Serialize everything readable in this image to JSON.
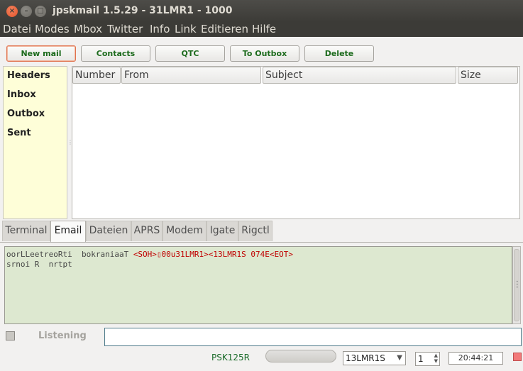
{
  "window": {
    "title": "jpskmail 1.5.29 - 31LMR1 - 1000",
    "controls": {
      "close": "×",
      "minimize": "–",
      "maximize": "□"
    }
  },
  "menu": [
    "Datei",
    "Modes",
    "Mbox",
    "Twitter",
    "Info",
    "Link",
    "Editieren",
    "Hilfe"
  ],
  "toolbar": [
    "New mail",
    "Contacts",
    "QTC",
    "To Outbox",
    "Delete"
  ],
  "sidebar": [
    "Headers",
    "Inbox",
    "Outbox",
    "Sent"
  ],
  "table": {
    "columns": [
      "Number",
      "From",
      "Subject",
      "Size"
    ],
    "rows": []
  },
  "tabs": [
    "Terminal",
    "Email",
    "Dateien",
    "APRS",
    "Modem",
    "Igate",
    "Rigctl"
  ],
  "active_tab": "Email",
  "terminal": {
    "line1_plain": "oorLLeetreoRti  bokraniaaT ",
    "line1_red": "<SOH>▯00u31LMR1><13LMR1S 074E<EOT>",
    "line2": "srnoi R  nrtpt"
  },
  "status": {
    "listening": "Listening",
    "mode": "PSK125R",
    "callsign": "13LMR1S",
    "spin_value": "1",
    "clock": "20:44:21"
  },
  "colors": {
    "terminal_bg": "#dde8d0",
    "sidebar_bg": "#fefed8",
    "button_text": "#1d6b1d",
    "indicator": "#f27a7a"
  }
}
